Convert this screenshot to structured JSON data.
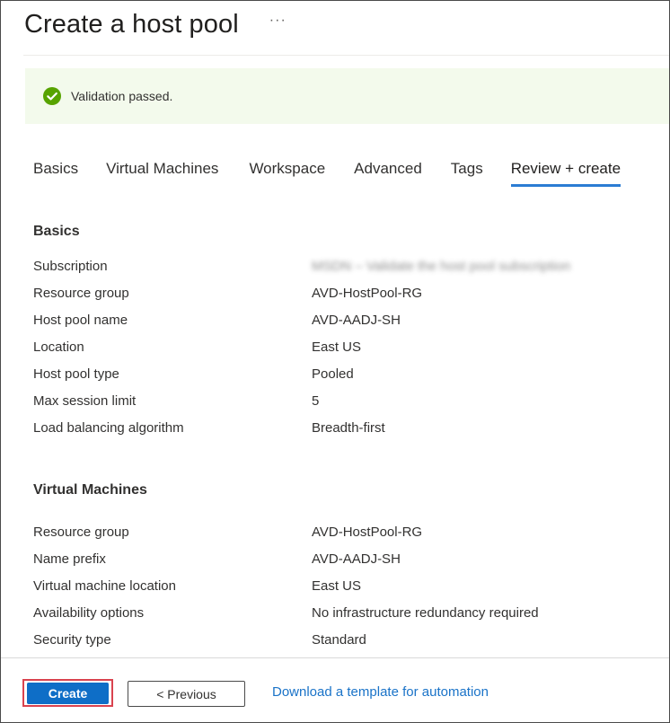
{
  "page": {
    "title": "Create a host pool",
    "more_label": "···"
  },
  "validation": {
    "message": "Validation passed.",
    "status_color": "#57a300"
  },
  "tabs": [
    {
      "label": "Basics"
    },
    {
      "label": "Virtual Machines"
    },
    {
      "label": "Workspace"
    },
    {
      "label": "Advanced"
    },
    {
      "label": "Tags"
    },
    {
      "label": "Review + create",
      "active": true
    }
  ],
  "basics": {
    "title": "Basics",
    "rows": [
      {
        "label": "Subscription",
        "value": "MSDN – Validate the host pool subscription",
        "redacted": true
      },
      {
        "label": "Resource group",
        "value": "AVD-HostPool-RG"
      },
      {
        "label": "Host pool name",
        "value": "AVD-AADJ-SH"
      },
      {
        "label": "Location",
        "value": "East US"
      },
      {
        "label": "Host pool type",
        "value": "Pooled"
      },
      {
        "label": "Max session limit",
        "value": "5"
      },
      {
        "label": "Load balancing algorithm",
        "value": "Breadth-first"
      }
    ]
  },
  "virtual_machines": {
    "title": "Virtual Machines",
    "rows": [
      {
        "label": "Resource group",
        "value": "AVD-HostPool-RG"
      },
      {
        "label": "Name prefix",
        "value": "AVD-AADJ-SH"
      },
      {
        "label": "Virtual machine location",
        "value": "East US"
      },
      {
        "label": "Availability options",
        "value": "No infrastructure redundancy required"
      },
      {
        "label": "Security type",
        "value": "Standard"
      }
    ]
  },
  "footer": {
    "create_label": "Create",
    "previous_label": "< Previous",
    "download_label": "Download a template for automation"
  },
  "colors": {
    "accent": "#0e6ec7",
    "highlight_border": "#d9434f",
    "banner_background": "#f3faec"
  }
}
